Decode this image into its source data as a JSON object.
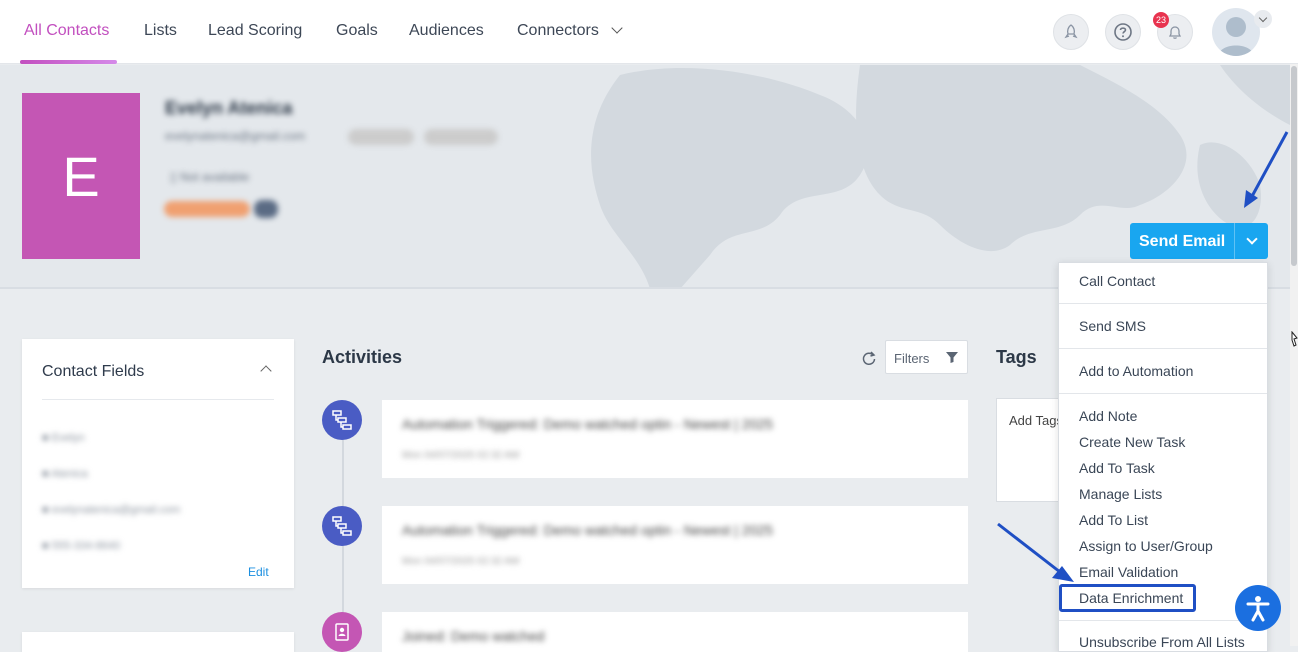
{
  "nav": {
    "tabs": [
      "All Contacts",
      "Lists",
      "Lead Scoring",
      "Goals",
      "Audiences",
      "Connectors"
    ],
    "notification_count": "23"
  },
  "contact": {
    "initial": "E",
    "name": "Evelyn Atenica",
    "email": "evelynatenica@gmail.com",
    "phone_status": "Not available"
  },
  "actions": {
    "send_email": "Send Email",
    "menu": [
      "Call Contact",
      "Send SMS",
      "Add to Automation",
      "Add Note",
      "Create New Task",
      "Add To Task",
      "Manage Lists",
      "Add To List",
      "Assign to User/Group",
      "Email Validation",
      "Data Enrichment",
      "Unsubscribe From All Lists"
    ]
  },
  "contact_fields": {
    "title": "Contact Fields",
    "rows": [
      "Evelyn",
      "Atenica",
      "evelynatenica@gmail.com",
      "555-334-8640"
    ],
    "edit": "Edit"
  },
  "activities": {
    "title": "Activities",
    "filters": "Filters",
    "items": [
      {
        "title": "Automation Triggered: Demo watched optin - Newest | 2025",
        "date": "Mon 04/07/2025 02:32 AM"
      },
      {
        "title": "Automation Triggered: Demo watched optin - Newest | 2025",
        "date": "Mon 04/07/2025 02:32 AM"
      },
      {
        "title": "Joined: Demo watched",
        "date": ""
      }
    ]
  },
  "tags": {
    "title": "Tags",
    "placeholder": "Add Tags"
  },
  "colors": {
    "accent": "#c24fbf",
    "primary": "#19a6f0",
    "highlight": "#1f4fc4"
  }
}
